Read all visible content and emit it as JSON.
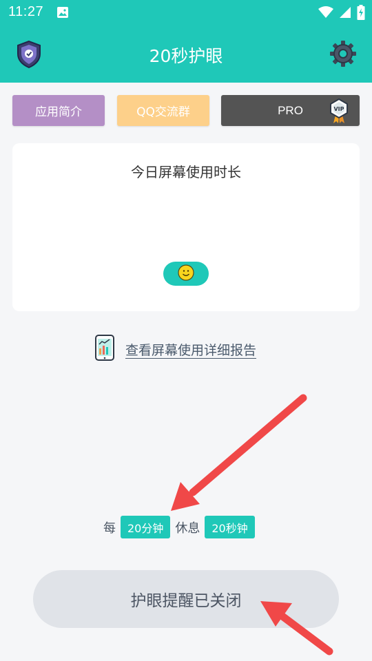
{
  "status_bar": {
    "time": "11:27",
    "icons": [
      "photo-icon",
      "wifi-icon",
      "signal-icon",
      "battery-charging-icon"
    ]
  },
  "app_bar": {
    "title": "20秒护眼",
    "left_icon": "shield-check-icon",
    "right_icon": "gear-icon"
  },
  "top_buttons": {
    "intro": "应用简介",
    "qq_group": "QQ交流群",
    "pro": "PRO",
    "pro_badge_icon": "vip-badge-icon"
  },
  "usage_card": {
    "title": "今日屏幕使用时长",
    "mood_icon": "smiley-icon"
  },
  "report_link": {
    "icon": "phone-chart-icon",
    "label": "查看屏幕使用详细报告"
  },
  "interval": {
    "prefix": "每",
    "work_value": "20分钟",
    "middle": "休息",
    "rest_value": "20秒钟"
  },
  "reminder_toggle": {
    "label": "护眼提醒已关闭"
  },
  "colors": {
    "accent": "#1fc8b8",
    "intro_button": "#b48fc6",
    "qq_button": "#fdd08a",
    "pro_button": "#545454",
    "annotation_arrow": "#f04848"
  }
}
